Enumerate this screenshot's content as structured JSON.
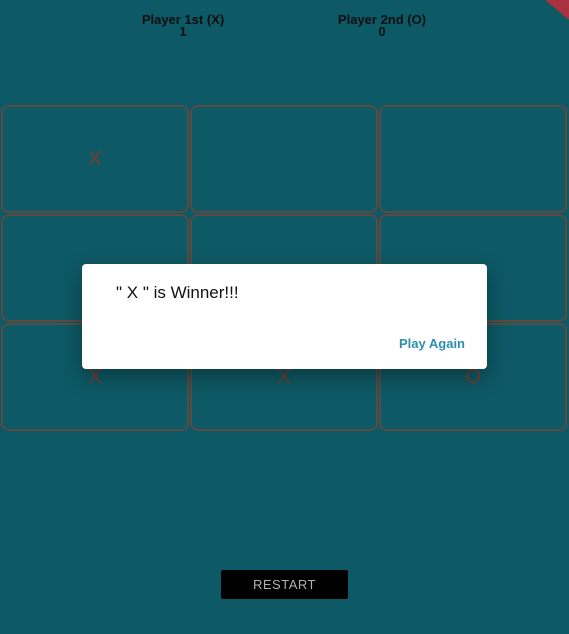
{
  "scoreboard": {
    "player1": {
      "label": "Player 1st (X)",
      "score": "1"
    },
    "player2": {
      "label": "Player 2nd (O)",
      "score": "0"
    }
  },
  "board": {
    "cells": [
      "X",
      "",
      "",
      "",
      "",
      "",
      "X",
      "X",
      "O"
    ]
  },
  "dialog": {
    "message": "\" X \" is Winner!!!",
    "action_label": "Play Again"
  },
  "restart_label": "RESTART",
  "colors": {
    "background": "#0d5965",
    "cell_border": "#5a4a42",
    "mark": "#7b3b2f",
    "dialog_action": "#2c8fb0",
    "banner": "#a8323d"
  }
}
